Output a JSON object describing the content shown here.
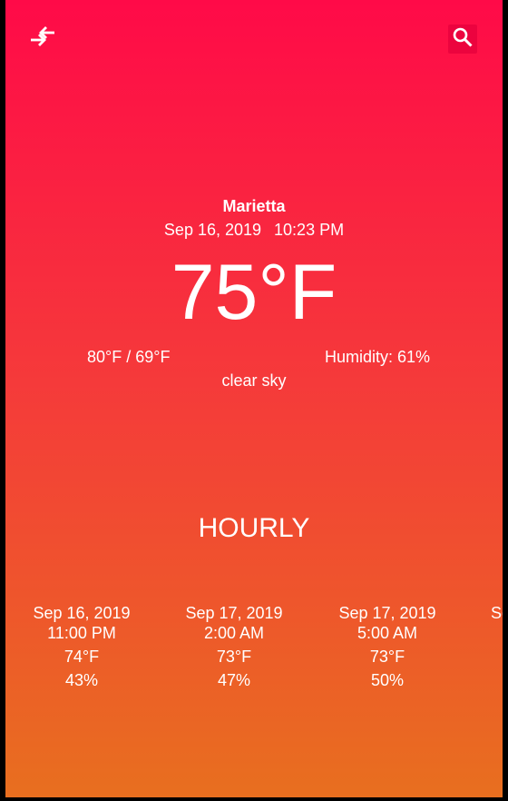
{
  "topbar": {
    "compare_icon": "swap-horizontal-icon",
    "search_icon": "search-icon"
  },
  "current": {
    "city": "Marietta",
    "date": "Sep 16, 2019",
    "time": "10:23 PM",
    "temperature": "75°F",
    "high_low": "80°F / 69°F",
    "humidity": "Humidity: 61%",
    "condition": "clear sky"
  },
  "hourly": {
    "title": "HOURLY",
    "items": [
      {
        "date": "Sep 16, 2019",
        "time": "11:00 PM",
        "temp": "74°F",
        "humidity": "43%"
      },
      {
        "date": "Sep 17, 2019",
        "time": "2:00 AM",
        "temp": "73°F",
        "humidity": "47%"
      },
      {
        "date": "Sep 17, 2019",
        "time": "5:00 AM",
        "temp": "73°F",
        "humidity": "50%"
      },
      {
        "date": "Se",
        "time": "",
        "temp": "",
        "humidity": ""
      }
    ]
  },
  "colors": {
    "gradient_top": "#ff0a48",
    "gradient_bottom": "#e86f1f",
    "text": "#ffffff"
  }
}
